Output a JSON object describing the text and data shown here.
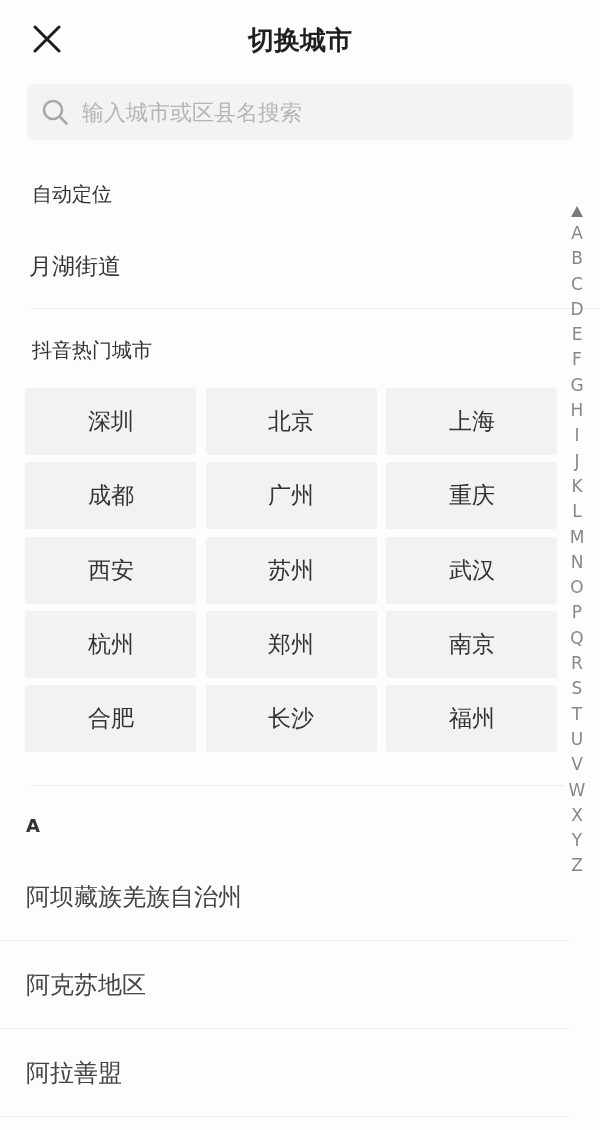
{
  "header": {
    "title": "切换城市"
  },
  "search": {
    "placeholder": "输入城市或区县名搜索"
  },
  "auto_location": {
    "heading": "自动定位",
    "location": "月湖街道"
  },
  "hot_cities": {
    "heading": "抖音热门城市",
    "cities": [
      "深圳",
      "北京",
      "上海",
      "成都",
      "广州",
      "重庆",
      "西安",
      "苏州",
      "武汉",
      "杭州",
      "郑州",
      "南京",
      "合肥",
      "长沙",
      "福州"
    ]
  },
  "city_list": [
    {
      "letter": "A",
      "cities": [
        "阿坝藏族羌族自治州",
        "阿克苏地区",
        "阿拉善盟"
      ]
    }
  ],
  "index_bar": {
    "letters": [
      "A",
      "B",
      "C",
      "D",
      "E",
      "F",
      "G",
      "H",
      "I",
      "J",
      "K",
      "L",
      "M",
      "N",
      "O",
      "P",
      "Q",
      "R",
      "S",
      "T",
      "U",
      "V",
      "W",
      "X",
      "Y",
      "Z"
    ]
  }
}
